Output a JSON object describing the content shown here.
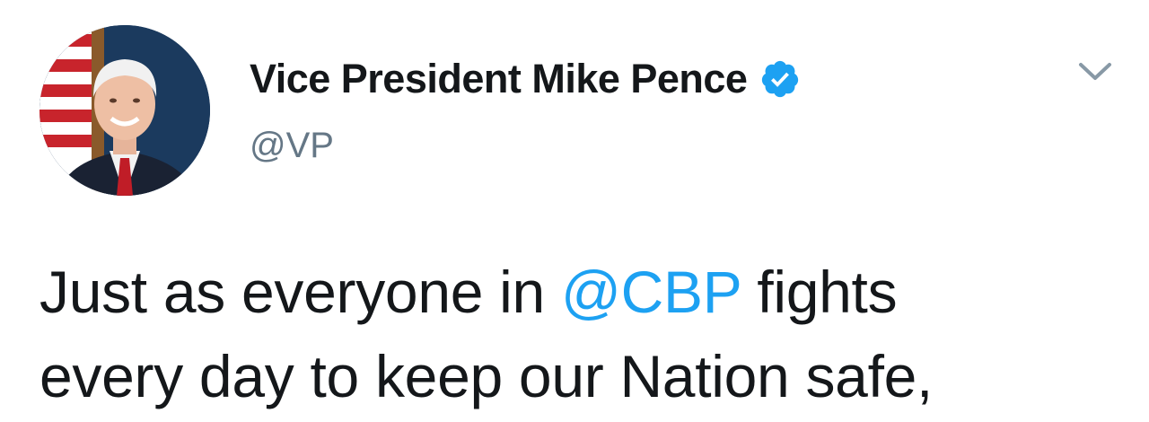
{
  "tweet": {
    "author": {
      "display_name": "Vice President Mike Pence",
      "handle": "@VP",
      "verified": true,
      "avatar_icon": "profile-photo"
    },
    "menu_icon": "chevron-down-icon",
    "body": {
      "line1_before": "Just as everyone in ",
      "mention": "@CBP",
      "line1_after": " fights",
      "line2": "every day to keep our Nation safe,"
    }
  },
  "colors": {
    "text_primary": "#14171a",
    "text_secondary": "#657786",
    "link": "#1da1f2",
    "verified_badge": "#1da1f2",
    "background": "#ffffff"
  }
}
